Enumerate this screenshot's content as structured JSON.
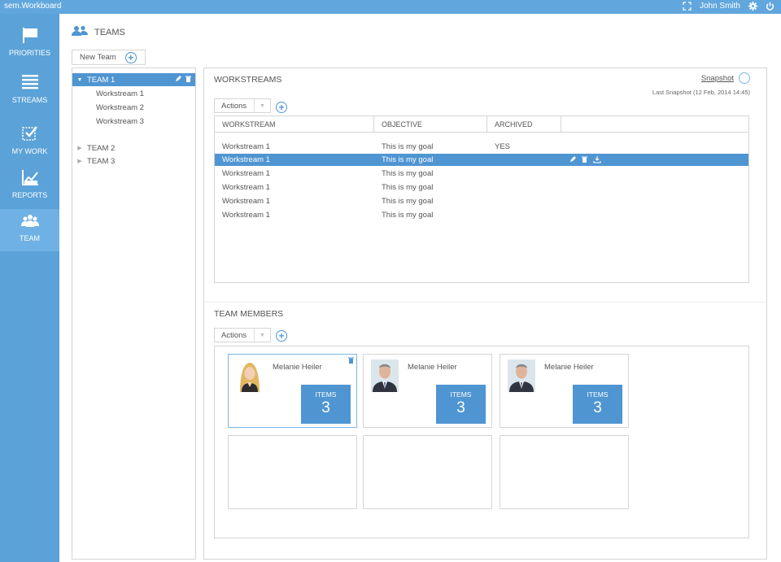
{
  "app": {
    "title": "sem.Workboard",
    "user": "John Smith"
  },
  "nav": [
    {
      "label": "PRIORITIES",
      "icon": "flag-icon"
    },
    {
      "label": "STREAMS",
      "icon": "streams-icon"
    },
    {
      "label": "MY WORK",
      "icon": "checkbox-icon"
    },
    {
      "label": "REPORTS",
      "icon": "chart-icon"
    },
    {
      "label": "TEAM",
      "icon": "team-icon",
      "active": true
    }
  ],
  "page": {
    "title": "TEAMS",
    "new_team_label": "New Team"
  },
  "teams": [
    {
      "name": "TEAM 1",
      "expanded": true,
      "children": [
        "Workstream 1",
        "Workstream 2",
        "Workstream 3"
      ]
    },
    {
      "name": "TEAM 2",
      "expanded": false
    },
    {
      "name": "TEAM 3",
      "expanded": false
    }
  ],
  "workstreams": {
    "title": "WORKSTREAMS",
    "snapshot_label": "Snapshot",
    "last_snapshot": "Last Snapshot (12 Feb, 2014 14:45)",
    "actions_label": "Actions",
    "columns": [
      "WORKSTREAM",
      "OBJECTIVE",
      "ARCHIVED"
    ],
    "rows": [
      {
        "workstream": "Workstream 1",
        "objective": "This is my goal",
        "archived": "YES"
      },
      {
        "workstream": "Workstream 1",
        "objective": "This is my goal",
        "archived": "",
        "selected": true
      },
      {
        "workstream": "Workstream 1",
        "objective": "This is my goal",
        "archived": ""
      },
      {
        "workstream": "Workstream 1",
        "objective": "This is my goal",
        "archived": ""
      },
      {
        "workstream": "Workstream 1",
        "objective": "This is my goal",
        "archived": ""
      },
      {
        "workstream": "Workstream 1",
        "objective": "This is my goal",
        "archived": ""
      }
    ]
  },
  "members": {
    "title": "TEAM MEMBERS",
    "actions_label": "Actions",
    "cards": [
      {
        "name": "Melanie Heiler",
        "items_label": "ITEMS",
        "items": "3",
        "avatar": "female"
      },
      {
        "name": "Melanie Heiler",
        "items_label": "ITEMS",
        "items": "3",
        "avatar": "male"
      },
      {
        "name": "Melanie Heiler",
        "items_label": "ITEMS",
        "items": "3",
        "avatar": "male"
      }
    ]
  },
  "colors": {
    "accent": "#4f95d2",
    "sidebar": "#5ba2d8",
    "topbar": "#61a7dd"
  }
}
